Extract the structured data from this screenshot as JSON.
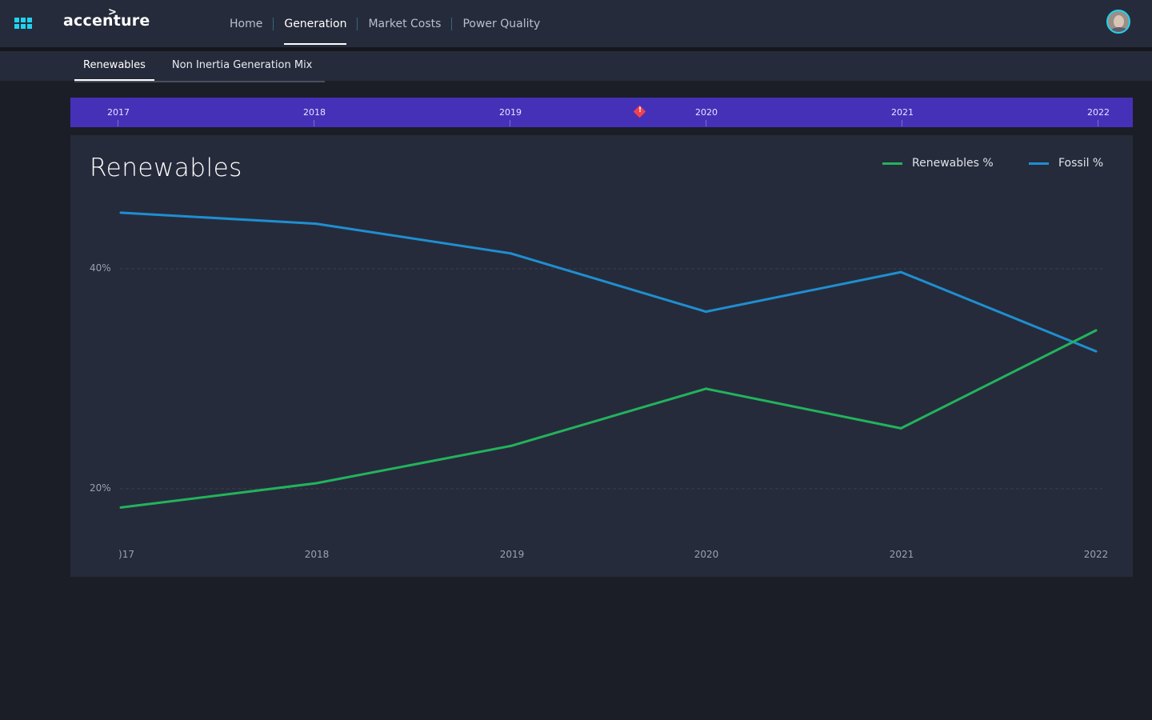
{
  "header": {
    "logo": "accenture",
    "nav": [
      "Home",
      "Generation",
      "Market Costs",
      "Power Quality"
    ],
    "active_nav": "Generation"
  },
  "subtabs": [
    "Renewables",
    "Non Inertia Generation Mix"
  ],
  "timeline": {
    "years": [
      "2017",
      "2018",
      "2019",
      "2020",
      "2021",
      "2022"
    ],
    "alert_color": "#f2404f",
    "bar_color": "#4431b8"
  },
  "chart_data": {
    "type": "line",
    "title": "Renewables",
    "categories": [
      "2017",
      "2018",
      "2019",
      "2020",
      "2021",
      "2022"
    ],
    "x_tick_labels": [
      ")17",
      "2018",
      "2019",
      "2020",
      "2021",
      "2022"
    ],
    "series": [
      {
        "name": "Renewables %",
        "color": "#22b35c",
        "values": [
          18.3,
          20.5,
          23.9,
          29.1,
          25.5,
          34.4
        ]
      },
      {
        "name": "Fossil %",
        "color": "#1e8fd0",
        "values": [
          45.1,
          44.1,
          41.4,
          36.1,
          39.7,
          32.5
        ]
      }
    ],
    "y_ticks": [
      "20%",
      "40%"
    ],
    "y_tick_values": [
      20,
      40
    ],
    "ylim": [
      20,
      40
    ],
    "grid": "dashed horizontal",
    "legend_position": "top-right"
  }
}
